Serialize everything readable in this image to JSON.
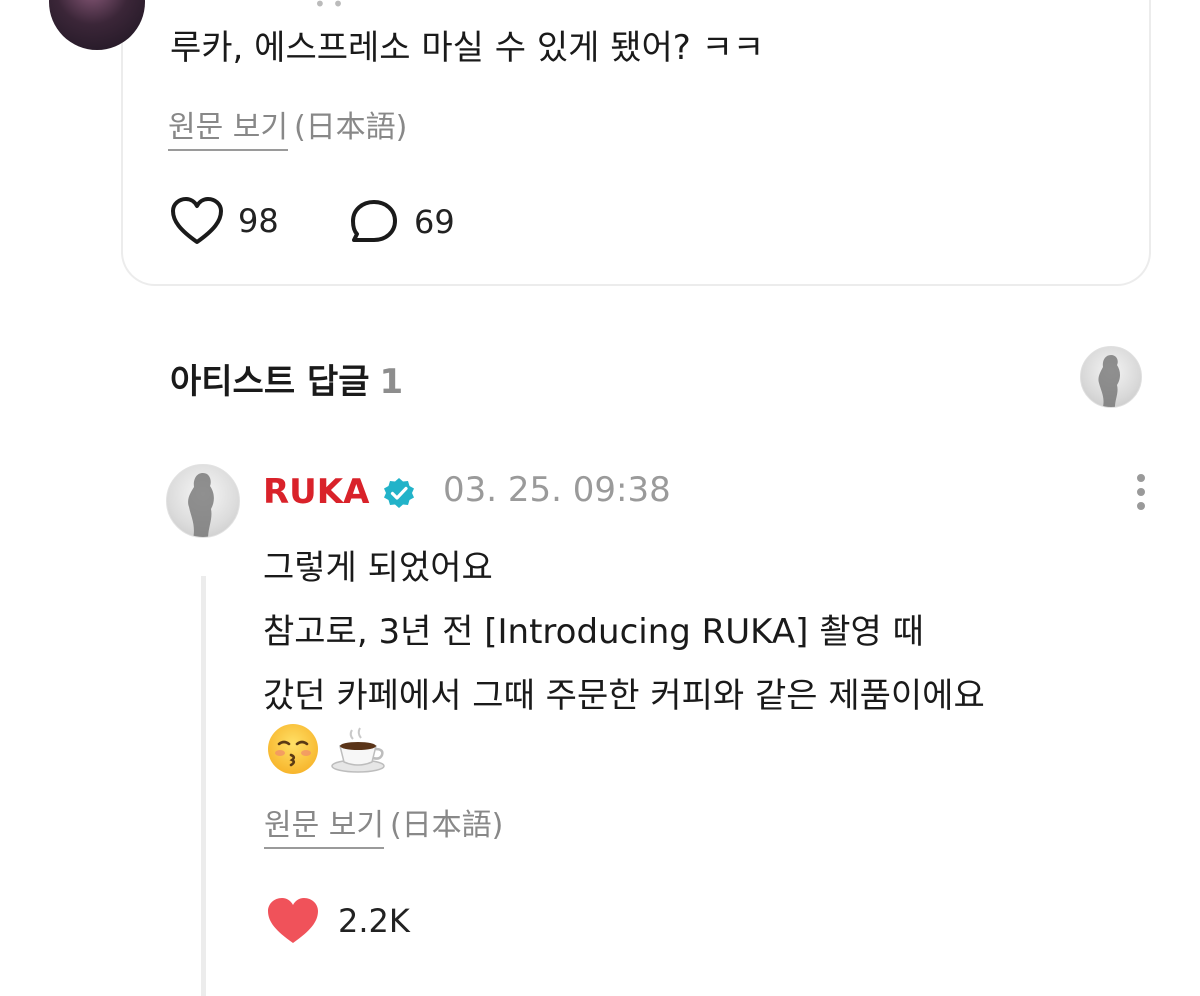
{
  "post": {
    "text": "루카, 에스프레소 마실 수 있게 됐어? ㅋㅋ",
    "translate_link": "원문 보기",
    "translate_lang": "(日本語)",
    "likes": "98",
    "comments": "69"
  },
  "artist_replies": {
    "title": "아티스트 답글",
    "count": "1"
  },
  "reply": {
    "name": "RUKA",
    "time": "03. 25. 09:38",
    "lines": [
      "그렇게 되었어요",
      "참고로, 3년 전 [Introducing RUKA] 촬영 때",
      "갔던 카페에서 그때 주문한 커피와 같은 제품이에요"
    ],
    "translate_link": "원문 보기",
    "translate_lang": "(日本語)",
    "likes": "2.2K"
  },
  "icons": {
    "heart_outline": "heart-outline-icon",
    "comment": "comment-bubble-icon",
    "verified": "verified-badge-icon",
    "more": "more-vertical-icon",
    "heart_filled": "heart-filled-icon",
    "emoji_kiss": "kissing-face-emoji",
    "emoji_coffee": "hot-beverage-emoji"
  },
  "colors": {
    "artist_name": "#d9222a",
    "verified": "#22b3c9",
    "liked_heart": "#f0525a"
  }
}
